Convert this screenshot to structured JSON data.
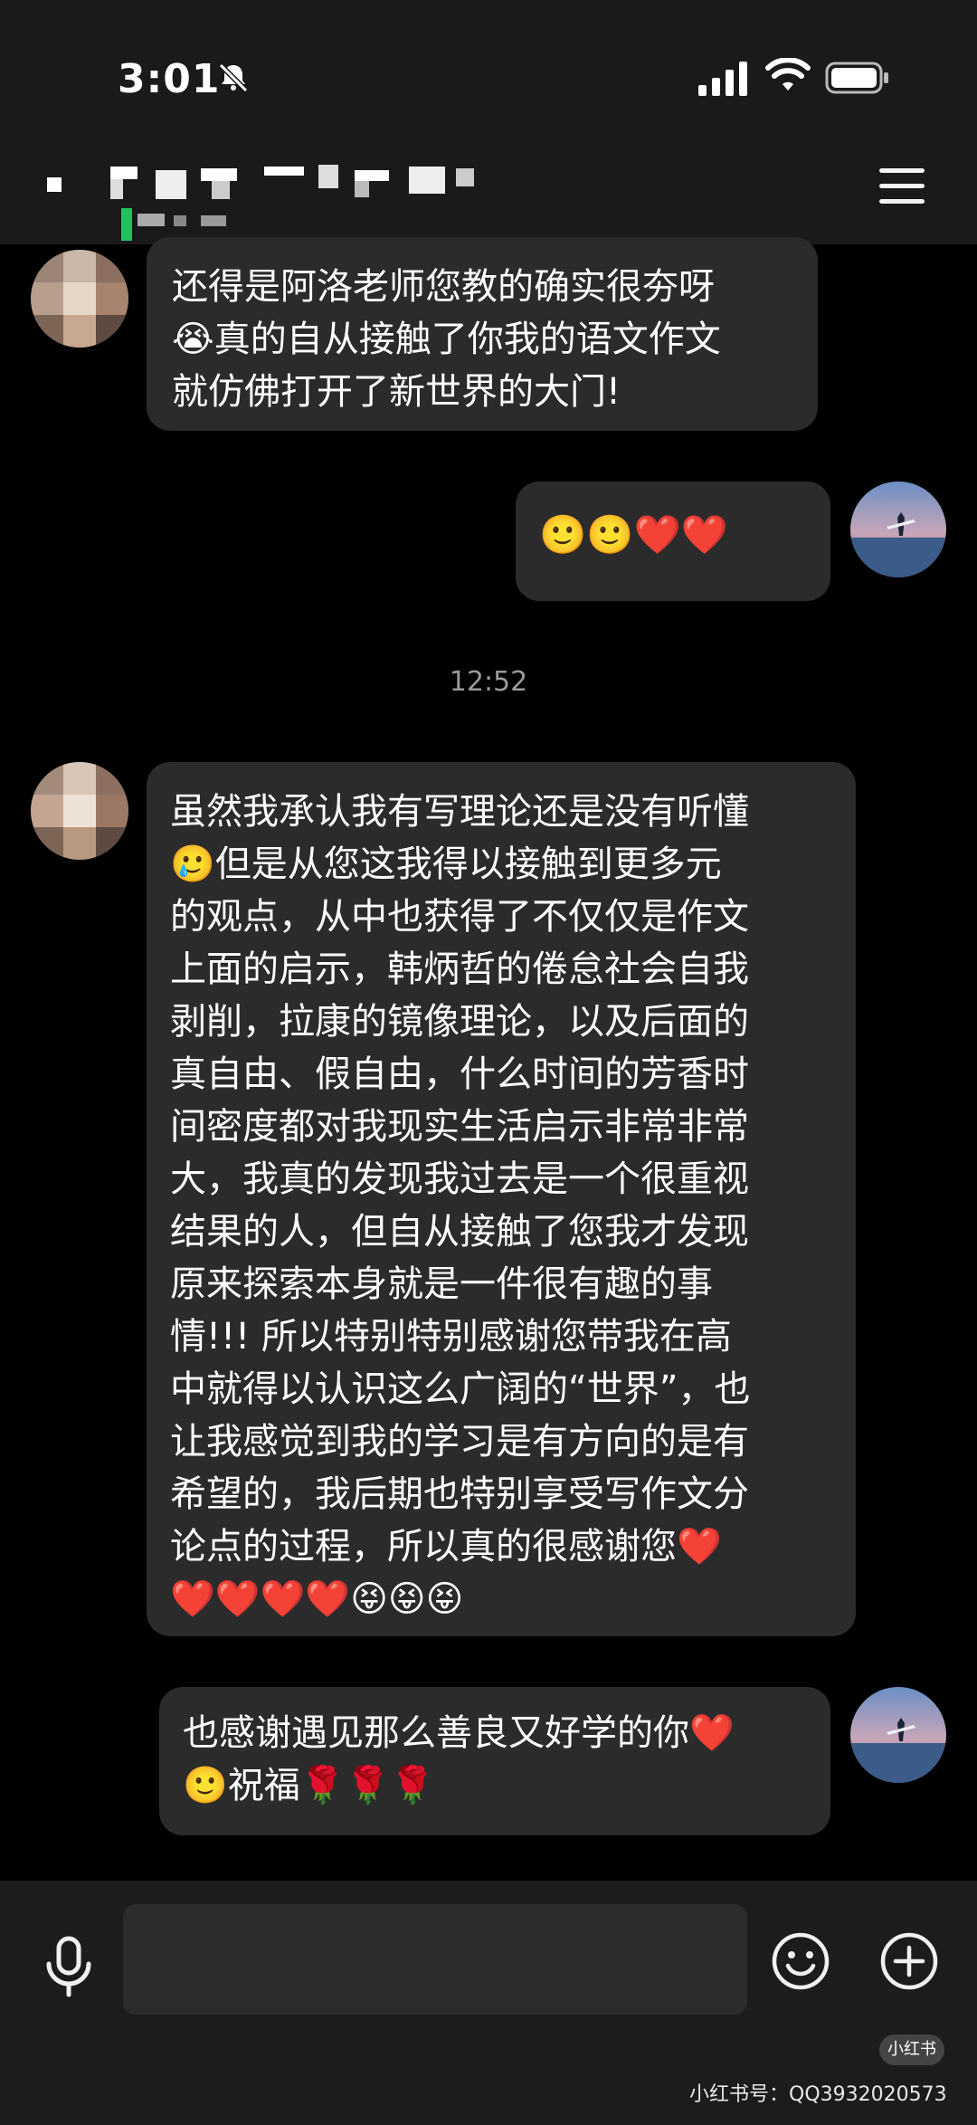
{
  "status_bar": {
    "time": "3:01"
  },
  "header": {
    "menu_icon": "hamburger-menu-icon"
  },
  "messages": [
    {
      "side": "left",
      "lines": [
        "还得是阿洛老师您教的确实很夯呀",
        "😭真的自从接触了你我的语文作文",
        "就仿佛打开了新世界的大门!"
      ]
    },
    {
      "side": "right",
      "lines": [
        "🙂🙂❤️❤️"
      ]
    },
    {
      "side": "left",
      "lines": [
        "虽然我承认我有写理论还是没有听懂",
        "🥲但是从您这我得以接触到更多元",
        "的观点，从中也获得了不仅仅是作文",
        "上面的启示，韩炳哲的倦怠社会自我",
        "剥削，拉康的镜像理论，以及后面的",
        "真自由、假自由，什么时间的芳香时",
        "间密度都对我现实生活启示非常非常",
        "大，我真的发现我过去是一个很重视",
        "结果的人，但自从接触了您我才发现",
        "原来探索本身就是一件很有趣的事",
        "情!!! 所以特别特别感谢您带我在高",
        "中就得以认识这么广阔的“世界”，也",
        "让我感觉到我的学习是有方向的是有",
        "希望的，我后期也特别享受写作文分",
        "论点的过程，所以真的很感谢您❤️",
        "❤️❤️❤️❤️😝😝😝"
      ]
    },
    {
      "side": "right",
      "lines": [
        "也感谢遇见那么善良又好学的你❤️",
        "🙂祝福🌹🌹🌹"
      ]
    }
  ],
  "timestamp": "12:52",
  "input": {
    "placeholder": ""
  },
  "watermark": {
    "badge": "小红书",
    "text": "小红书号：QQ3932020573"
  },
  "colors": {
    "background": "#000000",
    "bubble": "#2b2b2b",
    "bar": "#1c1c1c",
    "heart": "#e8242c"
  }
}
